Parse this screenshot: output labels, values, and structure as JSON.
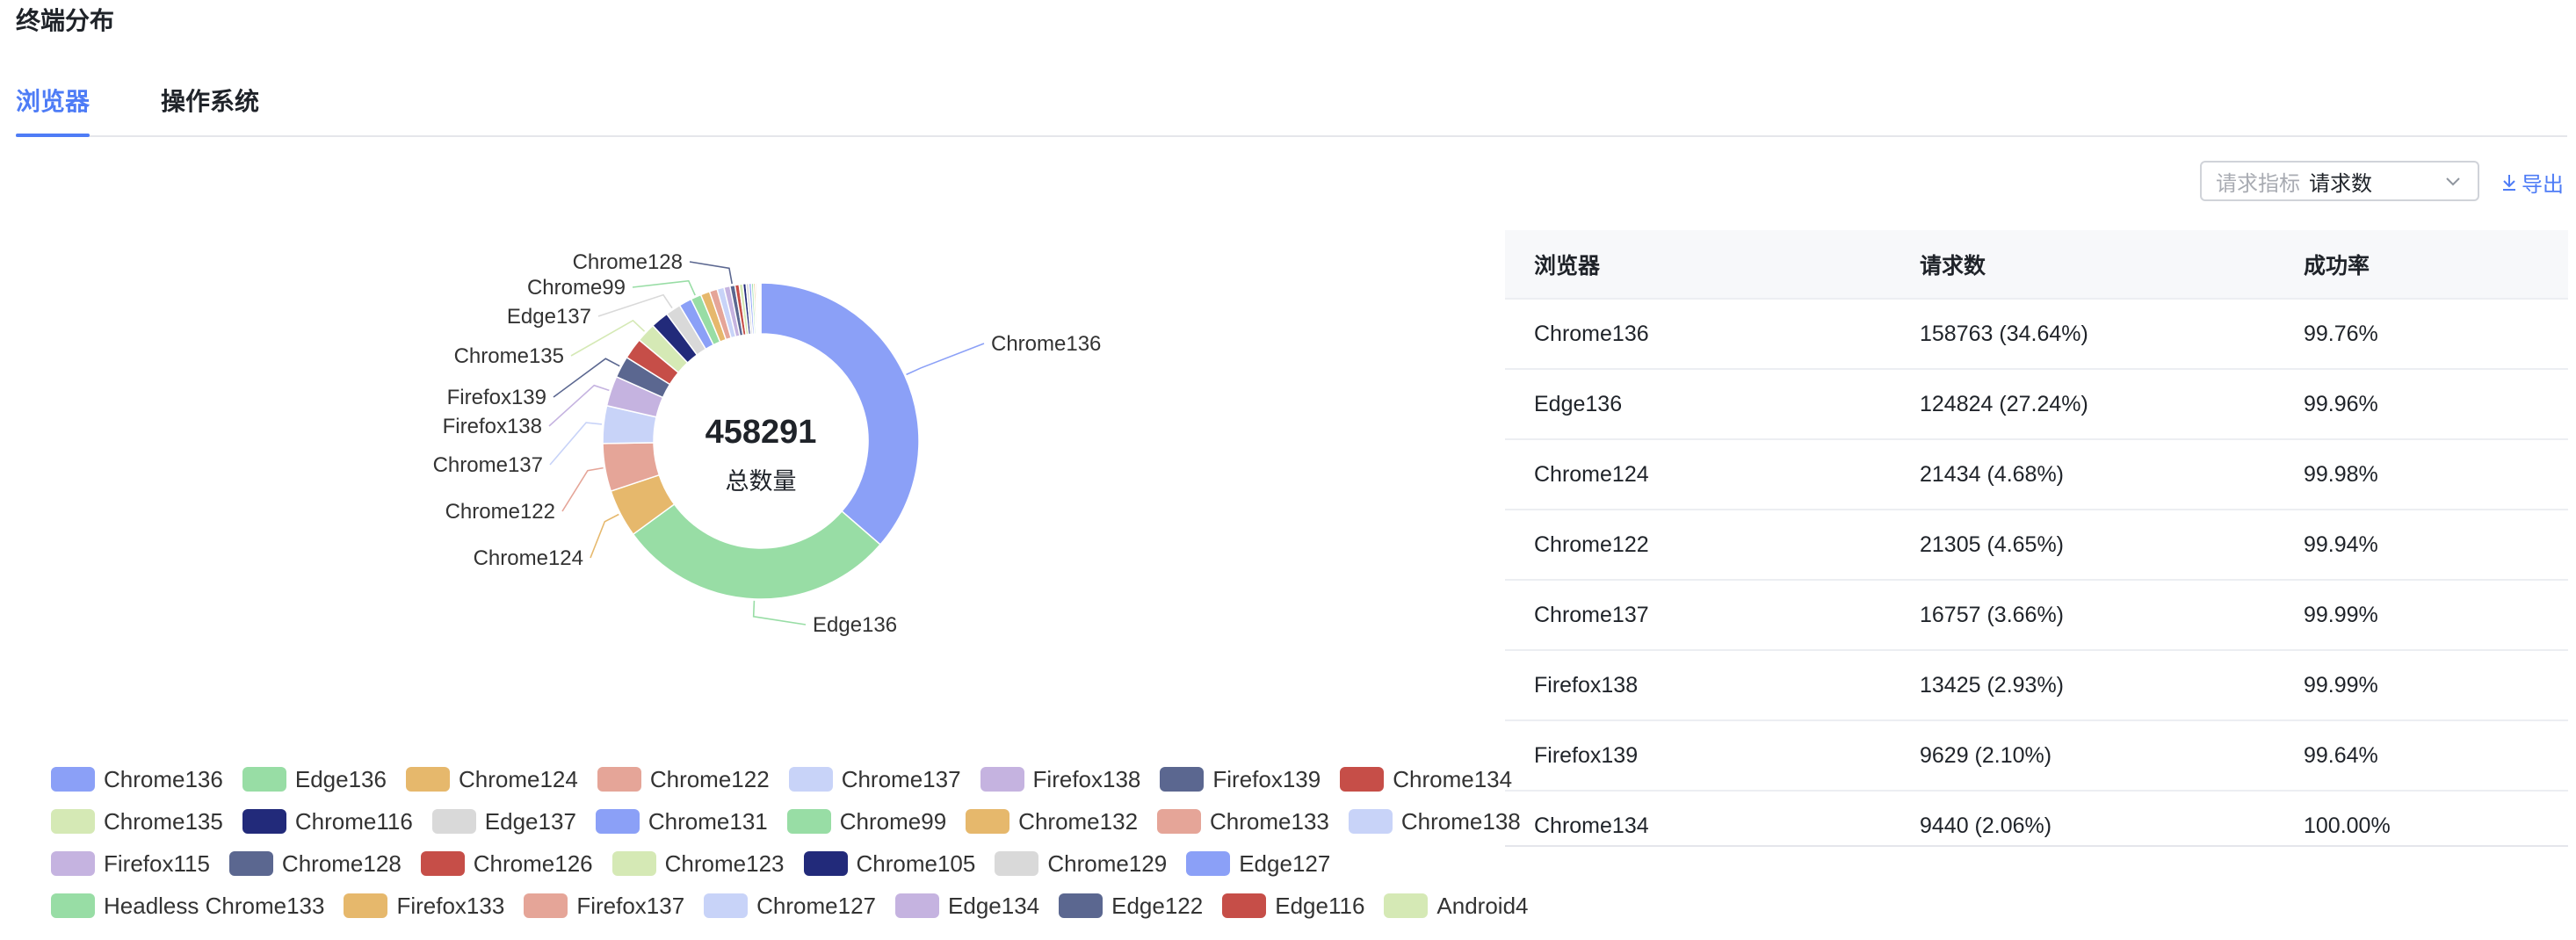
{
  "page": {
    "title": "终端分布",
    "tabs": [
      {
        "label": "浏览器",
        "active": true
      },
      {
        "label": "操作系统",
        "active": false
      }
    ]
  },
  "toolbar": {
    "metric_label": "请求指标",
    "metric_value": "请求数",
    "export_label": "导出"
  },
  "colors": {
    "accent": "#4e7cf6",
    "palette": [
      "#8ba0f7",
      "#98dda5",
      "#e6b86c",
      "#e5a598",
      "#c8d3f8",
      "#c5b3e0",
      "#5b6790",
      "#c64e48",
      "#d5e9b5",
      "#222a7a",
      "#d9d9d9",
      "#8ba0f7",
      "#98dda5",
      "#e6b86c",
      "#e5a598",
      "#c8d3f8",
      "#c5b3e0",
      "#5b6790",
      "#c64e48",
      "#d5e9b5",
      "#222a7a",
      "#d9d9d9",
      "#8ba0f7",
      "#98dda5",
      "#e6b86c",
      "#e5a598",
      "#c8d3f8",
      "#c5b3e0",
      "#5b6790",
      "#c64e48",
      "#d5e9b5"
    ]
  },
  "chart_data": {
    "type": "pie",
    "donut": true,
    "center_value": "458291",
    "center_label": "总数量",
    "total": 458291,
    "categories": [
      "Chrome136",
      "Edge136",
      "Chrome124",
      "Chrome122",
      "Chrome137",
      "Firefox138",
      "Firefox139",
      "Chrome134",
      "Chrome135",
      "Chrome116",
      "Edge137",
      "Chrome131",
      "Chrome99",
      "Chrome132",
      "Chrome133",
      "Chrome138",
      "Firefox115",
      "Chrome128",
      "Chrome126",
      "Chrome123",
      "Chrome105",
      "Chrome129",
      "Edge127",
      "Headless Chrome133",
      "Firefox133",
      "Firefox137",
      "Chrome127",
      "Edge134",
      "Edge122",
      "Edge116",
      "Android4"
    ],
    "values": [
      158763,
      124824,
      21434,
      21305,
      16757,
      13425,
      9629,
      9440,
      8700,
      8000,
      6800,
      5700,
      4700,
      4100,
      3500,
      3100,
      2700,
      2200,
      1900,
      1650,
      1400,
      1250,
      1100,
      950,
      800,
      680,
      560,
      450,
      350,
      250,
      150
    ],
    "callout_labels": [
      "Chrome136",
      "Edge136",
      "Chrome124",
      "Chrome122",
      "Chrome137",
      "Firefox138",
      "Firefox139",
      "Chrome135",
      "Edge137",
      "Chrome99",
      "Chrome128"
    ],
    "legend_rows": [
      [
        "Chrome136",
        "Edge136",
        "Chrome124",
        "Chrome122",
        "Chrome137",
        "Firefox138",
        "Firefox139",
        "Chrome134"
      ],
      [
        "Chrome135",
        "Chrome116",
        "Edge137",
        "Chrome131",
        "Chrome99",
        "Chrome132",
        "Chrome133",
        "Chrome138"
      ],
      [
        "Firefox115",
        "Chrome128",
        "Chrome126",
        "Chrome123",
        "Chrome105",
        "Chrome129",
        "Edge127"
      ],
      [
        "Headless Chrome133",
        "Firefox133",
        "Firefox137",
        "Chrome127",
        "Edge134",
        "Edge122",
        "Edge116",
        "Android4"
      ]
    ]
  },
  "table": {
    "headers": [
      "浏览器",
      "请求数",
      "成功率"
    ],
    "rows": [
      [
        "Chrome136",
        "158763 (34.64%)",
        "99.76%"
      ],
      [
        "Edge136",
        "124824 (27.24%)",
        "99.96%"
      ],
      [
        "Chrome124",
        "21434 (4.68%)",
        "99.98%"
      ],
      [
        "Chrome122",
        "21305 (4.65%)",
        "99.94%"
      ],
      [
        "Chrome137",
        "16757 (3.66%)",
        "99.99%"
      ],
      [
        "Firefox138",
        "13425 (2.93%)",
        "99.99%"
      ],
      [
        "Firefox139",
        "9629 (2.10%)",
        "99.64%"
      ],
      [
        "Chrome134",
        "9440 (2.06%)",
        "100.00%"
      ]
    ]
  }
}
